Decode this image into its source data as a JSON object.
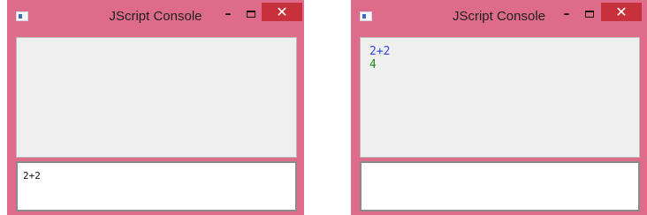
{
  "windows": [
    {
      "title": "JScript Console",
      "output_lines": [],
      "input_value": "2+2"
    },
    {
      "title": "JScript Console",
      "output_lines": [
        {
          "text": "2+2",
          "kind": "command",
          "color": "#3048d8"
        },
        {
          "text": "4",
          "kind": "result",
          "color": "#1f8a1f"
        }
      ],
      "input_value": ""
    }
  ],
  "controls": {
    "minimize_glyph": "–",
    "close_glyph": "✕"
  },
  "colors": {
    "window_frame": "#df6b8a",
    "close_button": "#c7313c",
    "output_bg": "#efefef"
  }
}
